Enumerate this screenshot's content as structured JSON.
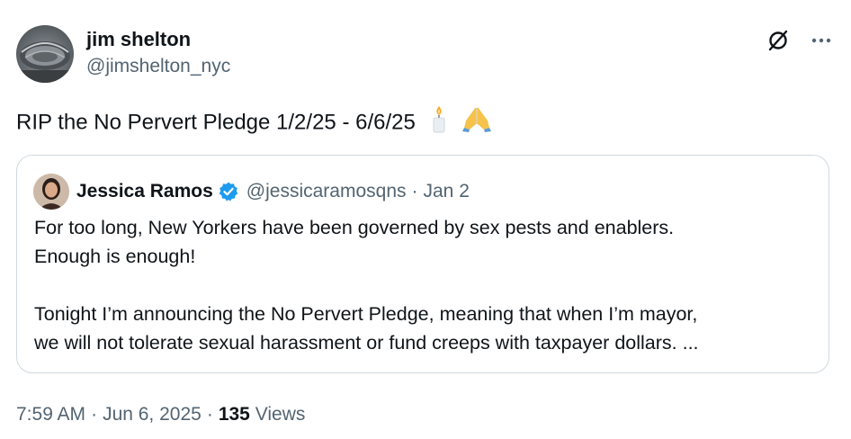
{
  "author": {
    "name": "jim shelton",
    "handle": "@jimshelton_nyc",
    "avatar_icon": "stadium-photo-avatar"
  },
  "actions": {
    "grok_icon": "slashed-circle-icon",
    "more_icon": "more-dots-icon",
    "more_label": "···"
  },
  "tweet": {
    "text": "RIP the No Pervert Pledge 1/2/25 - 6/6/25",
    "emojis": [
      "candle",
      "folded-hands"
    ]
  },
  "quote": {
    "name": "Jessica Ramos",
    "verified": true,
    "handle": "@jessicaramosqns",
    "dot": "·",
    "date": "Jan 2",
    "line1": "For too long, New Yorkers have been governed by sex pests and enablers.",
    "line2": "Enough is enough!",
    "line3": "Tonight I’m announcing the No Pervert Pledge, meaning that when I’m mayor,",
    "line4": "we will not tolerate sexual harassment or fund creeps with taxpayer dollars. ..."
  },
  "meta": {
    "time": "7:59 AM",
    "sep1": "·",
    "date": "Jun 6, 2025",
    "sep2": "·",
    "views_count": "135",
    "views_label": "Views"
  },
  "colors": {
    "text": "#0f1419",
    "secondary": "#536471",
    "border": "#cfd9de",
    "verified": "#1d9bf0"
  }
}
